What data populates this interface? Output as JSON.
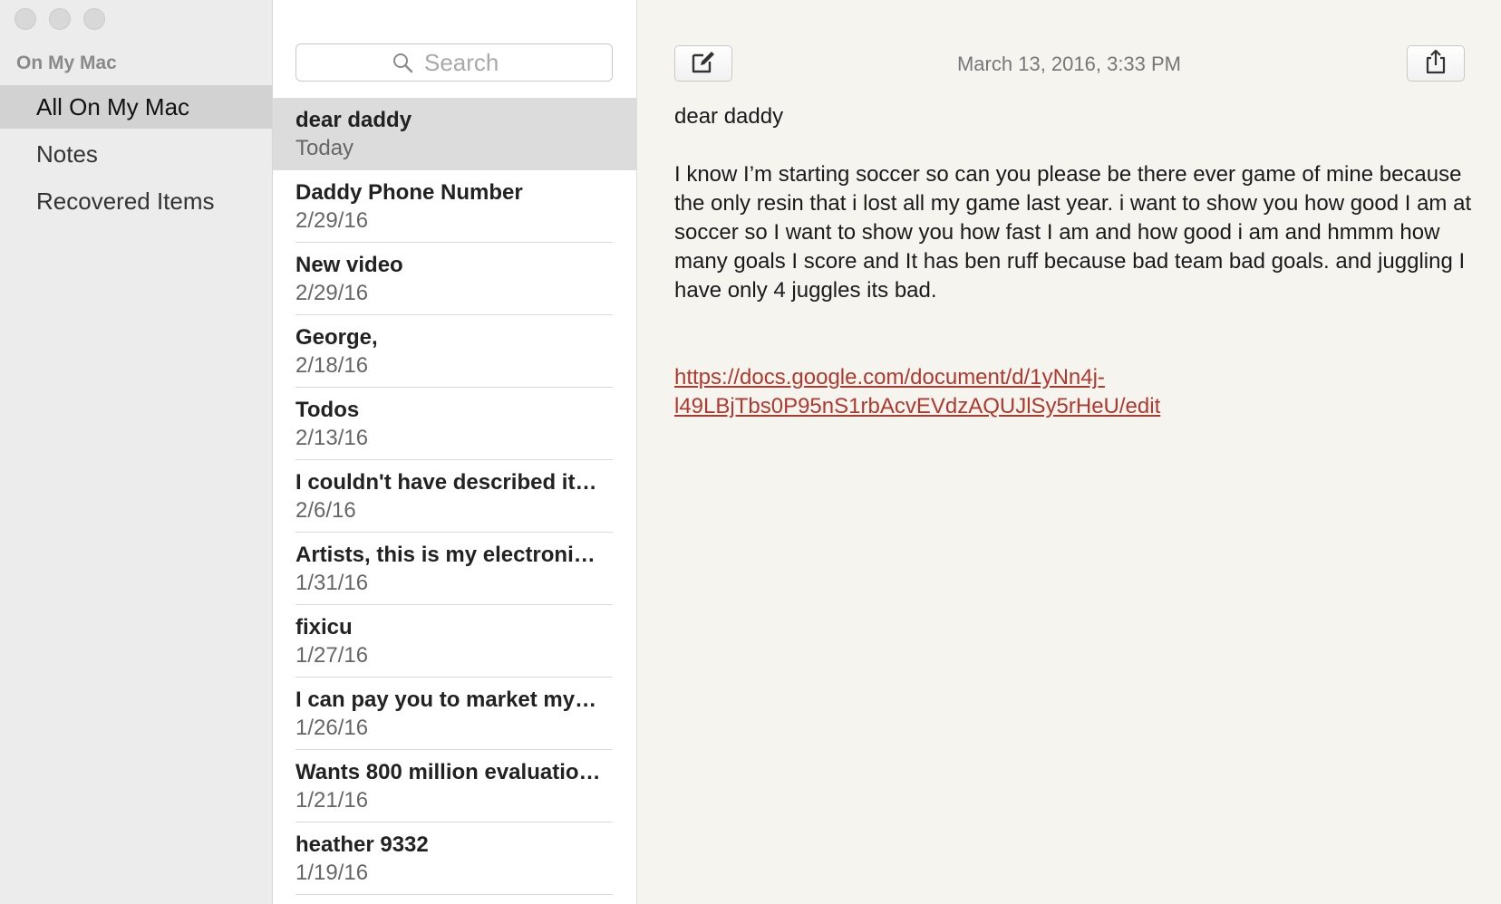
{
  "sidebar": {
    "section_title": "On My Mac",
    "items": [
      {
        "label": "All On My Mac"
      },
      {
        "label": "Notes"
      },
      {
        "label": "Recovered Items"
      }
    ]
  },
  "search": {
    "placeholder": "Search"
  },
  "notes": [
    {
      "title": "dear daddy",
      "date": "Today"
    },
    {
      "title": "Daddy Phone Number",
      "date": "2/29/16"
    },
    {
      "title": "New video",
      "date": "2/29/16"
    },
    {
      "title": "George,",
      "date": "2/18/16"
    },
    {
      "title": "Todos",
      "date": "2/13/16"
    },
    {
      "title": "I couldn't have described it…",
      "date": "2/6/16"
    },
    {
      "title": "Artists, this is my electroni…",
      "date": "1/31/16"
    },
    {
      "title": "fixicu",
      "date": "1/27/16"
    },
    {
      "title": "I can pay you to market my…",
      "date": "1/26/16"
    },
    {
      "title": "Wants 800 million evaluatio…",
      "date": "1/21/16"
    },
    {
      "title": "heather 9332",
      "date": "1/19/16"
    }
  ],
  "editor": {
    "timestamp": "March 13, 2016, 3:33 PM",
    "title_line": "dear daddy",
    "paragraph": "I know I’m starting soccer so can you please be there ever game of mine because the only resin that i lost all my game last year. i want to show you how good I am at soccer so I want to show you how fast I am and how good i am  and hmmm how many goals I score and It has ben ruff because bad team bad goals. and juggling I have only 4 juggles its bad.",
    "link_line1": "https://docs.google.com/document/d/1yNn4j-",
    "link_line2": "l49LBjTbs0P95nS1rbAcvEVdzAQUJlSy5rHeU/edit"
  },
  "colors": {
    "link": "#b0392e",
    "selected_row": "#dcdcdc",
    "sidebar_active": "#d2d2d2"
  },
  "icons": {
    "compose": "compose-icon",
    "share": "share-icon",
    "search": "search-icon"
  }
}
